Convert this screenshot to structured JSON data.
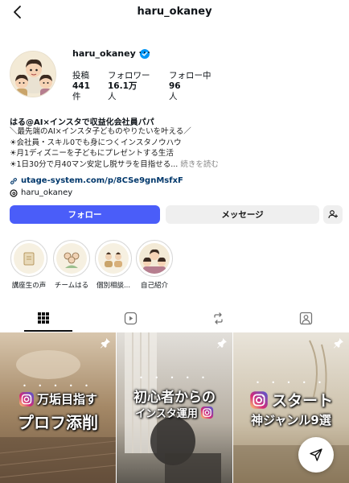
{
  "header": {
    "handle": "haru_okaney"
  },
  "profile": {
    "username": "haru_okaney",
    "stats": [
      {
        "label": "投稿",
        "value": "441",
        "unit": "件"
      },
      {
        "label": "フォロワー",
        "value": "16.1万",
        "unit": "人"
      },
      {
        "label": "フォロー中",
        "value": "96",
        "unit": "人"
      }
    ]
  },
  "bio": {
    "name": "はる@AI×インスタで収益化会社員パパ",
    "lines": [
      "＼最先端のAI×インスタ子どものやりたいを叶える／",
      "☀会社員・スキル0でも身につくインスタノウハウ",
      "☀月1ディズニーを子どもにプレゼントする生活",
      "☀1日30分で月40マン安定し脱サラを目指せる..."
    ],
    "more_label": "続きを読む",
    "link": "utage-system.com/p/8CSe9gnMsfxF",
    "threads": "haru_okaney"
  },
  "actions": {
    "follow": "フォロー",
    "message": "メッセージ"
  },
  "highlights": [
    {
      "label": "講座生の声"
    },
    {
      "label": "チームはる"
    },
    {
      "label": "個別相談..."
    },
    {
      "label": "自己紹介"
    }
  ],
  "posts": [
    {
      "line1": "万垢目指す",
      "line2": "プロフ添削"
    },
    {
      "line1": "初心者からの",
      "line2": "インスタ運用"
    },
    {
      "line1": "スタート",
      "line2": "神ジャンル9選"
    }
  ],
  "colors": {
    "primary": "#4a5df9",
    "link": "#00376b",
    "verified": "#0095f6"
  }
}
